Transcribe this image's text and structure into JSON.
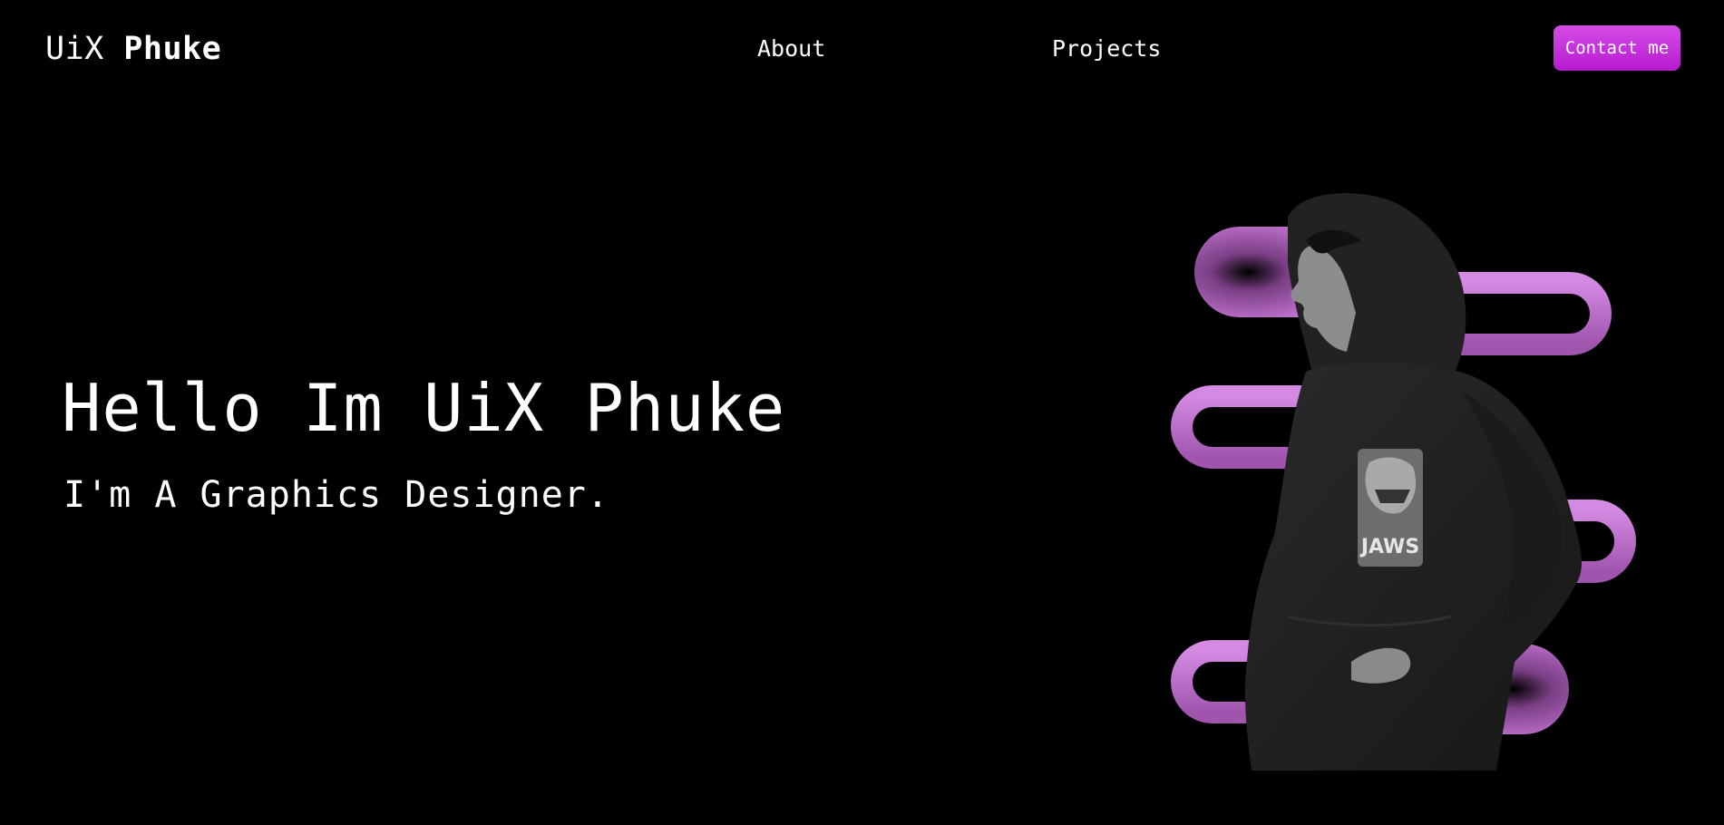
{
  "nav": {
    "logo": {
      "light": "UiX",
      "bold": "Phuke"
    },
    "links": [
      {
        "label": "About"
      },
      {
        "label": "Projects"
      }
    ],
    "contact_label": "Contact me"
  },
  "hero": {
    "title": "Hello Im UiX Phuke",
    "subtitle": "I'm A Graphics Designer.",
    "image": {
      "icon": "person-hoodie-portrait",
      "shirt_text": "JAWS"
    }
  },
  "colors": {
    "background": "#000000",
    "text": "#ffffff",
    "accent": "#c233d8",
    "pill": "#c977d8"
  }
}
